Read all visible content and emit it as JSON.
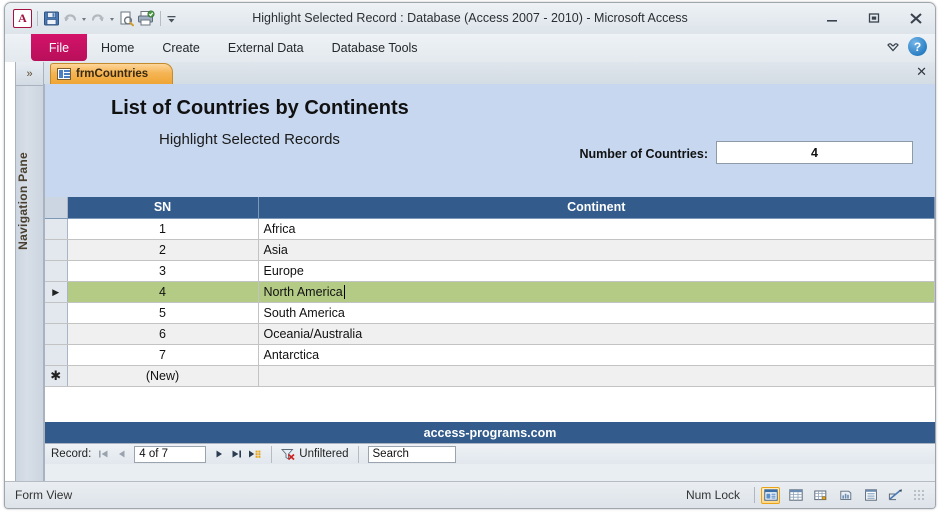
{
  "window": {
    "title": "Highlight Selected Record : Database (Access 2007 - 2010)  -  Microsoft Access",
    "minimize_label": "–",
    "restore_label": "❐",
    "close_label": "✕"
  },
  "quick_access": {
    "logo_label": "A",
    "items": [
      {
        "name": "save-icon",
        "tooltip": "Save"
      },
      {
        "name": "undo-icon",
        "tooltip": "Undo"
      },
      {
        "name": "redo-icon",
        "tooltip": "Redo"
      },
      {
        "name": "print-preview-icon",
        "tooltip": "Print Preview"
      },
      {
        "name": "print-icon",
        "tooltip": "Print"
      },
      {
        "name": "customize-qat-icon",
        "tooltip": "Customize Quick Access Toolbar"
      }
    ]
  },
  "ribbon": {
    "file_tab": "File",
    "tabs": [
      "Home",
      "Create",
      "External Data",
      "Database Tools"
    ],
    "collapse_icon": "⌄",
    "help_label": "?"
  },
  "navigation_pane": {
    "expand_icon": "»",
    "label": "Navigation Pane"
  },
  "document_tabs": {
    "tabs": [
      {
        "label": "frmCountries",
        "icon": "form-icon",
        "active": true
      }
    ],
    "close_label": "✕"
  },
  "form": {
    "title": "List of Countries by Continents",
    "subtitle": "Highlight Selected Records",
    "count_label": "Number of Countries:",
    "count_value": "4",
    "footer": "access-programs.com",
    "header_bg": "#c6d7ef",
    "header_band_color": "#335c8c",
    "selection_color": "#b4cb85"
  },
  "datasheet": {
    "columns": [
      "",
      "SN",
      "Continent"
    ],
    "rows": [
      {
        "marker": "",
        "sn": "1",
        "continent": "Africa",
        "selected": false
      },
      {
        "marker": "",
        "sn": "2",
        "continent": "Asia",
        "selected": false
      },
      {
        "marker": "",
        "sn": "3",
        "continent": "Europe",
        "selected": false
      },
      {
        "marker": "▶",
        "sn": "4",
        "continent": "North America",
        "selected": true
      },
      {
        "marker": "",
        "sn": "5",
        "continent": "South America",
        "selected": false
      },
      {
        "marker": "",
        "sn": "6",
        "continent": "Oceania/Australia",
        "selected": false
      },
      {
        "marker": "",
        "sn": "7",
        "continent": "Antarctica",
        "selected": false
      },
      {
        "marker": "✱",
        "sn": "(New)",
        "continent": "",
        "selected": false
      }
    ]
  },
  "record_nav": {
    "label": "Record:",
    "first_icon": "⏮",
    "prev_icon": "◀",
    "position": "4 of 7",
    "next_icon": "▶",
    "last_icon": "⏭",
    "new_icon": "▶✱",
    "filter_status": "Unfiltered",
    "search_placeholder": "Search"
  },
  "status_bar": {
    "view_text": "Form View",
    "num_lock": "Num Lock",
    "views": [
      {
        "name": "form-view-button",
        "active": true
      },
      {
        "name": "datasheet-view-button",
        "active": false
      },
      {
        "name": "pivottable-view-button",
        "active": false
      },
      {
        "name": "pivotchart-view-button",
        "active": false
      },
      {
        "name": "layout-view-button",
        "active": false
      },
      {
        "name": "design-view-button",
        "active": false
      }
    ]
  }
}
